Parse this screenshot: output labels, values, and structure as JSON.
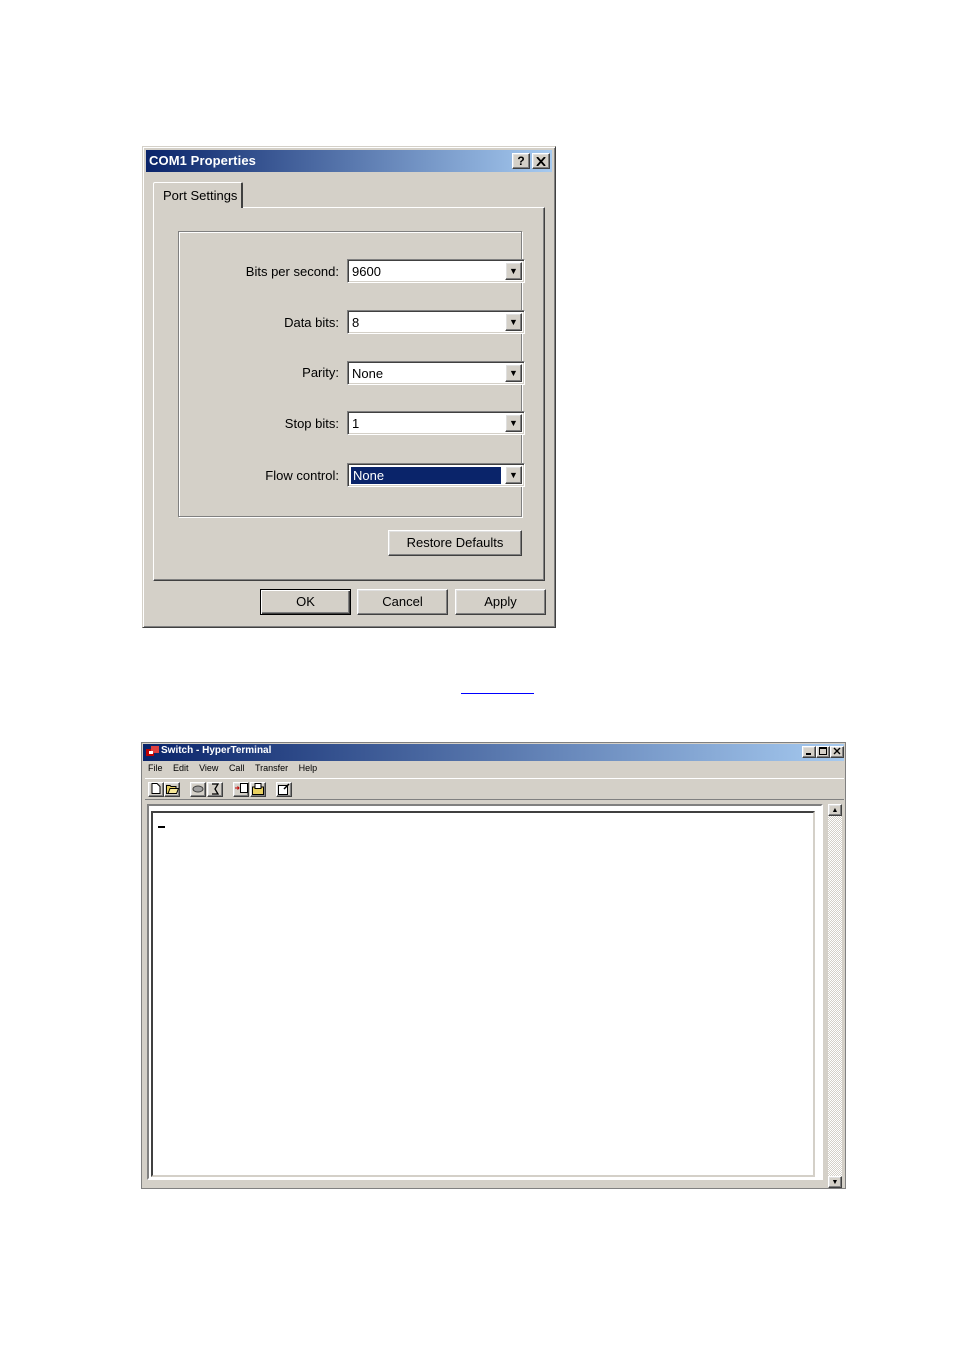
{
  "com_dialog": {
    "title": "COM1 Properties",
    "help_label": "?",
    "close_label": "✕",
    "tab_label": "Port Settings",
    "fields": [
      {
        "label": "Bits per second:",
        "value": "9600"
      },
      {
        "label": "Data bits:",
        "value": "8"
      },
      {
        "label": "Parity:",
        "value": "None"
      },
      {
        "label": "Stop bits:",
        "value": "1"
      },
      {
        "label": "Flow control:",
        "value": "None"
      }
    ],
    "restore_defaults_label": "Restore Defaults",
    "ok_label": "OK",
    "cancel_label": "Cancel",
    "apply_label": "Apply"
  },
  "link": {
    "text": ""
  },
  "hyperterminal": {
    "title": "Switch - HyperTerminal",
    "menu": [
      "File",
      "Edit",
      "View",
      "Call",
      "Transfer",
      "Help"
    ],
    "toolbar_icons": [
      "new-icon",
      "open-icon",
      "disconnect-phone-icon",
      "dial-icon",
      "send-icon",
      "receive-icon",
      "properties-icon"
    ],
    "terminal_cursor": "_"
  },
  "colors": {
    "titlebar_start": "#0a246a",
    "titlebar_end": "#a6caf0",
    "face": "#d4d0c8",
    "selection": "#0a246a",
    "link": "#0000ff"
  }
}
